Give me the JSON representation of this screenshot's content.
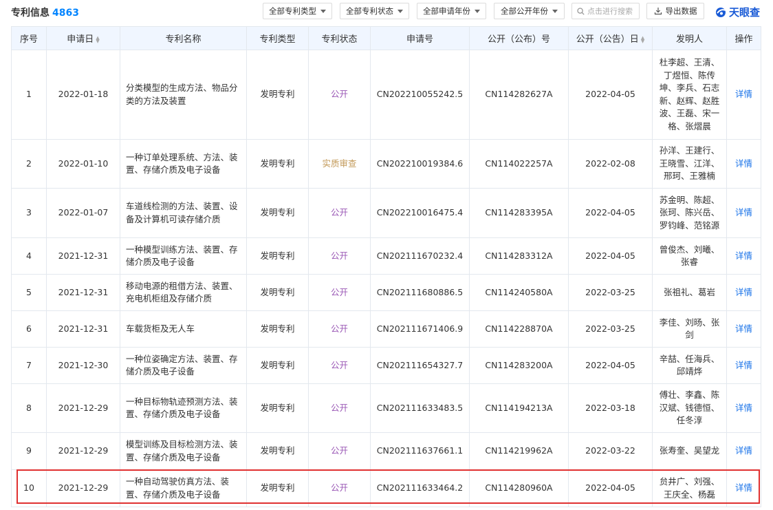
{
  "header": {
    "title": "专利信息",
    "count": "4863",
    "filters": [
      {
        "label": "全部专利类型"
      },
      {
        "label": "全部专利状态"
      },
      {
        "label": "全部申请年份"
      },
      {
        "label": "全部公开年份"
      }
    ],
    "search_placeholder": "点击进行搜索",
    "export_label": "导出数据",
    "logo_text": "天眼查"
  },
  "columns": [
    "序号",
    "申请日",
    "专利名称",
    "专利类型",
    "专利状态",
    "申请号",
    "公开（公布）号",
    "公开（公告）日",
    "发明人",
    "操作"
  ],
  "rows": [
    {
      "no": "1",
      "apply_date": "2022-01-18",
      "name": [
        "分类模型的生成方法、物品分",
        "类的方法及装置"
      ],
      "type": "发明专利",
      "status": "公开",
      "app_no": "CN202210055242.5",
      "pub_no": "CN114282627A",
      "pub_date": "2022-04-05",
      "inventors": [
        "杜李超、王清、",
        "丁煜恒、陈传",
        "坤、李兵、石志",
        "新、赵辉、赵胜",
        "波、王磊、宋一",
        "格、张熠晨"
      ],
      "action": "详情"
    },
    {
      "no": "2",
      "apply_date": "2022-01-10",
      "name": [
        "一种订单处理系统、方法、装",
        "置、存储介质及电子设备"
      ],
      "type": "发明专利",
      "status": "实质审查",
      "app_no": "CN202210019384.6",
      "pub_no": "CN114022257A",
      "pub_date": "2022-02-08",
      "inventors": [
        "孙洋、王建行、",
        "王晓雪、江洋、",
        "邢珂、王雅楠"
      ],
      "action": "详情"
    },
    {
      "no": "3",
      "apply_date": "2022-01-07",
      "name": [
        "车道线检测的方法、装置、设",
        "备及计算机可读存储介质"
      ],
      "type": "发明专利",
      "status": "公开",
      "app_no": "CN202210016475.4",
      "pub_no": "CN114283395A",
      "pub_date": "2022-04-05",
      "inventors": [
        "苏金明、陈超、",
        "张珂、陈兴岳、",
        "罗钧峰、范铭源"
      ],
      "action": "详情"
    },
    {
      "no": "4",
      "apply_date": "2021-12-31",
      "name": [
        "一种模型训练方法、装置、存",
        "储介质及电子设备"
      ],
      "type": "发明专利",
      "status": "公开",
      "app_no": "CN202111670232.4",
      "pub_no": "CN114283312A",
      "pub_date": "2022-04-05",
      "inventors": [
        "曾俊杰、刘曦、",
        "张睿"
      ],
      "action": "详情"
    },
    {
      "no": "5",
      "apply_date": "2021-12-31",
      "name": [
        "移动电源的租借方法、装置、",
        "充电机柜组及存储介质"
      ],
      "type": "发明专利",
      "status": "公开",
      "app_no": "CN202111680886.5",
      "pub_no": "CN114240580A",
      "pub_date": "2022-03-25",
      "inventors": [
        "张祖礼、葛岩"
      ],
      "action": "详情"
    },
    {
      "no": "6",
      "apply_date": "2021-12-31",
      "name": [
        "车载货柜及无人车"
      ],
      "type": "发明专利",
      "status": "公开",
      "app_no": "CN202111671406.9",
      "pub_no": "CN114228870A",
      "pub_date": "2022-03-25",
      "inventors": [
        "李佳、刘旸、张",
        "剑"
      ],
      "action": "详情"
    },
    {
      "no": "7",
      "apply_date": "2021-12-30",
      "name": [
        "一种位姿确定方法、装置、存",
        "储介质及电子设备"
      ],
      "type": "发明专利",
      "status": "公开",
      "app_no": "CN202111654327.7",
      "pub_no": "CN114283200A",
      "pub_date": "2022-04-05",
      "inventors": [
        "辛喆、任海兵、",
        "邱靖烨"
      ],
      "action": "详情"
    },
    {
      "no": "8",
      "apply_date": "2021-12-29",
      "name": [
        "一种目标物轨迹预测方法、装",
        "置、存储介质及电子设备"
      ],
      "type": "发明专利",
      "status": "公开",
      "app_no": "CN202111633483.5",
      "pub_no": "CN114194213A",
      "pub_date": "2022-03-18",
      "inventors": [
        "傅壮、李鑫、陈",
        "汉斌、钱德恒、",
        "任冬淳"
      ],
      "action": "详情"
    },
    {
      "no": "9",
      "apply_date": "2021-12-29",
      "name": [
        "模型训练及目标检测方法、装",
        "置、存储介质及电子设备"
      ],
      "type": "发明专利",
      "status": "公开",
      "app_no": "CN202111637661.1",
      "pub_no": "CN114219962A",
      "pub_date": "2022-03-22",
      "inventors": [
        "张寿奎、吴望龙"
      ],
      "action": "详情"
    },
    {
      "no": "10",
      "apply_date": "2021-12-29",
      "name": [
        "一种自动驾驶仿真方法、装",
        "置、存储介质及电子设备"
      ],
      "type": "发明专利",
      "status": "公开",
      "app_no": "CN202111633464.2",
      "pub_no": "CN114280960A",
      "pub_date": "2022-04-05",
      "inventors": [
        "贠井广、刘强、",
        "王庆全、杨磊"
      ],
      "action": "详情"
    }
  ],
  "colors": {
    "accent": "#0084ff",
    "status_public": "#9b59b6",
    "status_exam": "#c39a5a",
    "link": "#1a73e8",
    "highlight": "#e03030",
    "header_bg": "#f0f6ff"
  }
}
